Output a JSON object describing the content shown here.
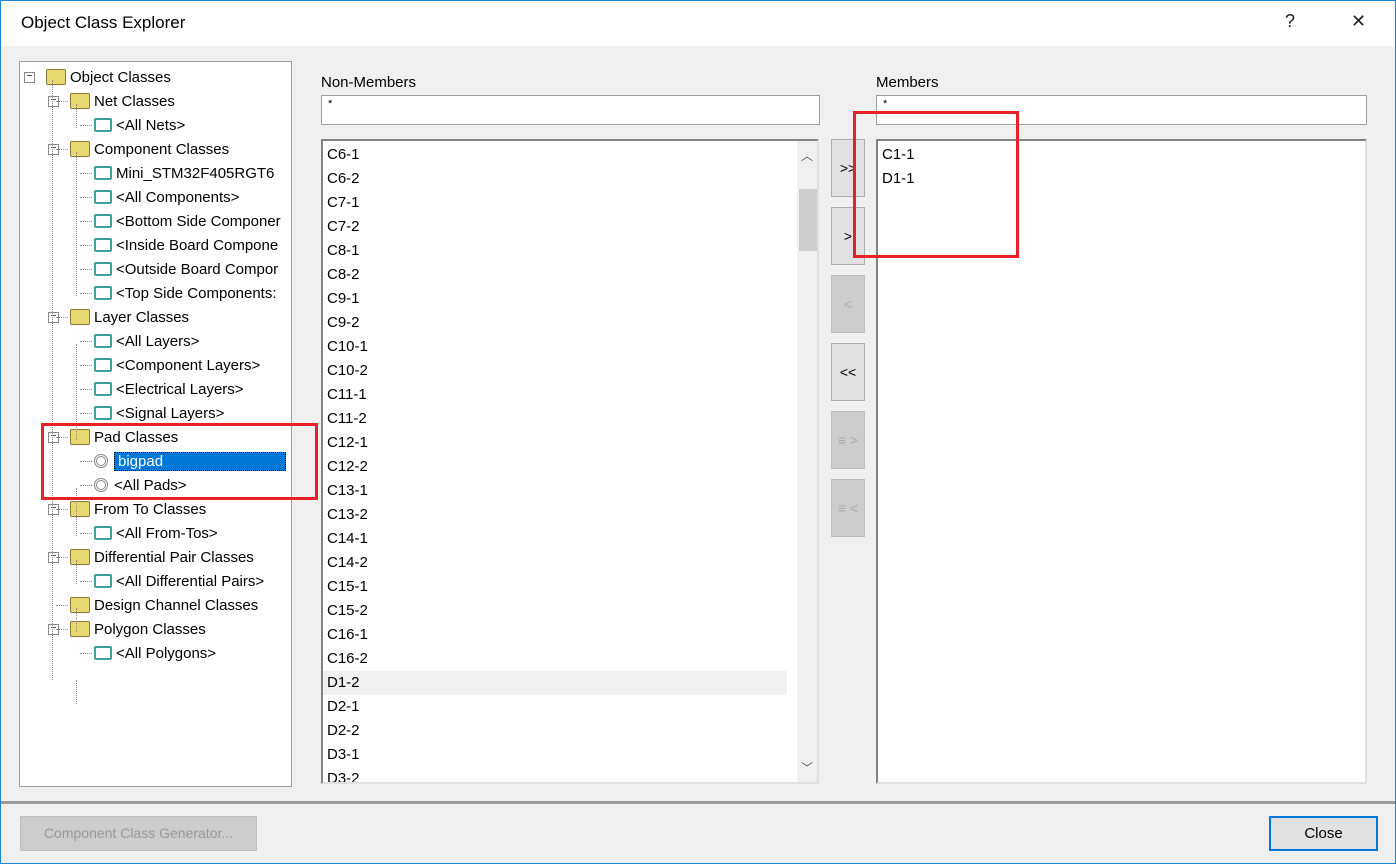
{
  "window": {
    "title": "Object Class Explorer",
    "help": "?",
    "close": "✕"
  },
  "tree": [
    {
      "label": "Object Classes",
      "level": 0,
      "type": "folder",
      "expanded": true
    },
    {
      "label": "Net Classes",
      "level": 1,
      "type": "folder",
      "expanded": true
    },
    {
      "label": "<All Nets>",
      "level": 2,
      "type": "net"
    },
    {
      "label": "Component Classes",
      "level": 1,
      "type": "folder",
      "expanded": true
    },
    {
      "label": "Mini_STM32F405RGT6",
      "level": 2,
      "type": "component"
    },
    {
      "label": "<All Components>",
      "level": 2,
      "type": "component"
    },
    {
      "label": "<Bottom Side Componer",
      "level": 2,
      "type": "component"
    },
    {
      "label": "<Inside Board Compone",
      "level": 2,
      "type": "component"
    },
    {
      "label": "<Outside Board Compor",
      "level": 2,
      "type": "component"
    },
    {
      "label": "<Top Side Components:",
      "level": 2,
      "type": "component"
    },
    {
      "label": "Layer Classes",
      "level": 1,
      "type": "folder",
      "expanded": true
    },
    {
      "label": "<All Layers>",
      "level": 2,
      "type": "layer"
    },
    {
      "label": "<Component Layers>",
      "level": 2,
      "type": "layer"
    },
    {
      "label": "<Electrical Layers>",
      "level": 2,
      "type": "layer"
    },
    {
      "label": "<Signal Layers>",
      "level": 2,
      "type": "layer"
    },
    {
      "label": "Pad Classes",
      "level": 1,
      "type": "folder",
      "expanded": true
    },
    {
      "label": "bigpad",
      "level": 2,
      "type": "pad",
      "selected": true
    },
    {
      "label": "<All Pads>",
      "level": 2,
      "type": "pad"
    },
    {
      "label": "From To Classes",
      "level": 1,
      "type": "folder",
      "expanded": true
    },
    {
      "label": "<All From-Tos>",
      "level": 2,
      "type": "fromto"
    },
    {
      "label": "Differential Pair Classes",
      "level": 1,
      "type": "folder",
      "expanded": true
    },
    {
      "label": "<All Differential Pairs>",
      "level": 2,
      "type": "fromto"
    },
    {
      "label": "Design Channel Classes",
      "level": 1,
      "type": "folder",
      "expanded": false
    },
    {
      "label": "Polygon Classes",
      "level": 1,
      "type": "folder",
      "expanded": true
    },
    {
      "label": "<All Polygons>",
      "level": 2,
      "type": "layer"
    }
  ],
  "non_members": {
    "label": "Non-Members",
    "filter": "*",
    "items": [
      "C6-1",
      "C6-2",
      "C7-1",
      "C7-2",
      "C8-1",
      "C8-2",
      "C9-1",
      "C9-2",
      "C10-1",
      "C10-2",
      "C11-1",
      "C11-2",
      "C12-1",
      "C12-2",
      "C13-1",
      "C13-2",
      "C14-1",
      "C14-2",
      "C15-1",
      "C15-2",
      "C16-1",
      "C16-2",
      "D1-2",
      "D2-1",
      "D2-2",
      "D3-1",
      "D3-2"
    ],
    "highlighted": "D1-2"
  },
  "members": {
    "label": "Members",
    "filter": "*",
    "items": [
      "C1-1",
      "D1-1"
    ]
  },
  "move_buttons": [
    {
      "label": ">>",
      "name": "add-all-button",
      "enabled": true
    },
    {
      "label": ">",
      "name": "add-button",
      "enabled": true
    },
    {
      "label": "<",
      "name": "remove-button",
      "enabled": false
    },
    {
      "label": "<<",
      "name": "remove-all-button",
      "enabled": true
    },
    {
      "label": "≡ >",
      "name": "add-selected-button",
      "enabled": false
    },
    {
      "label": "≡ <",
      "name": "remove-selected-button",
      "enabled": false
    }
  ],
  "footer": {
    "generator": "Component Class Generator...",
    "close": "Close"
  },
  "colors": {
    "selection": "#0078d7",
    "highlight_box": "#e8202a"
  }
}
